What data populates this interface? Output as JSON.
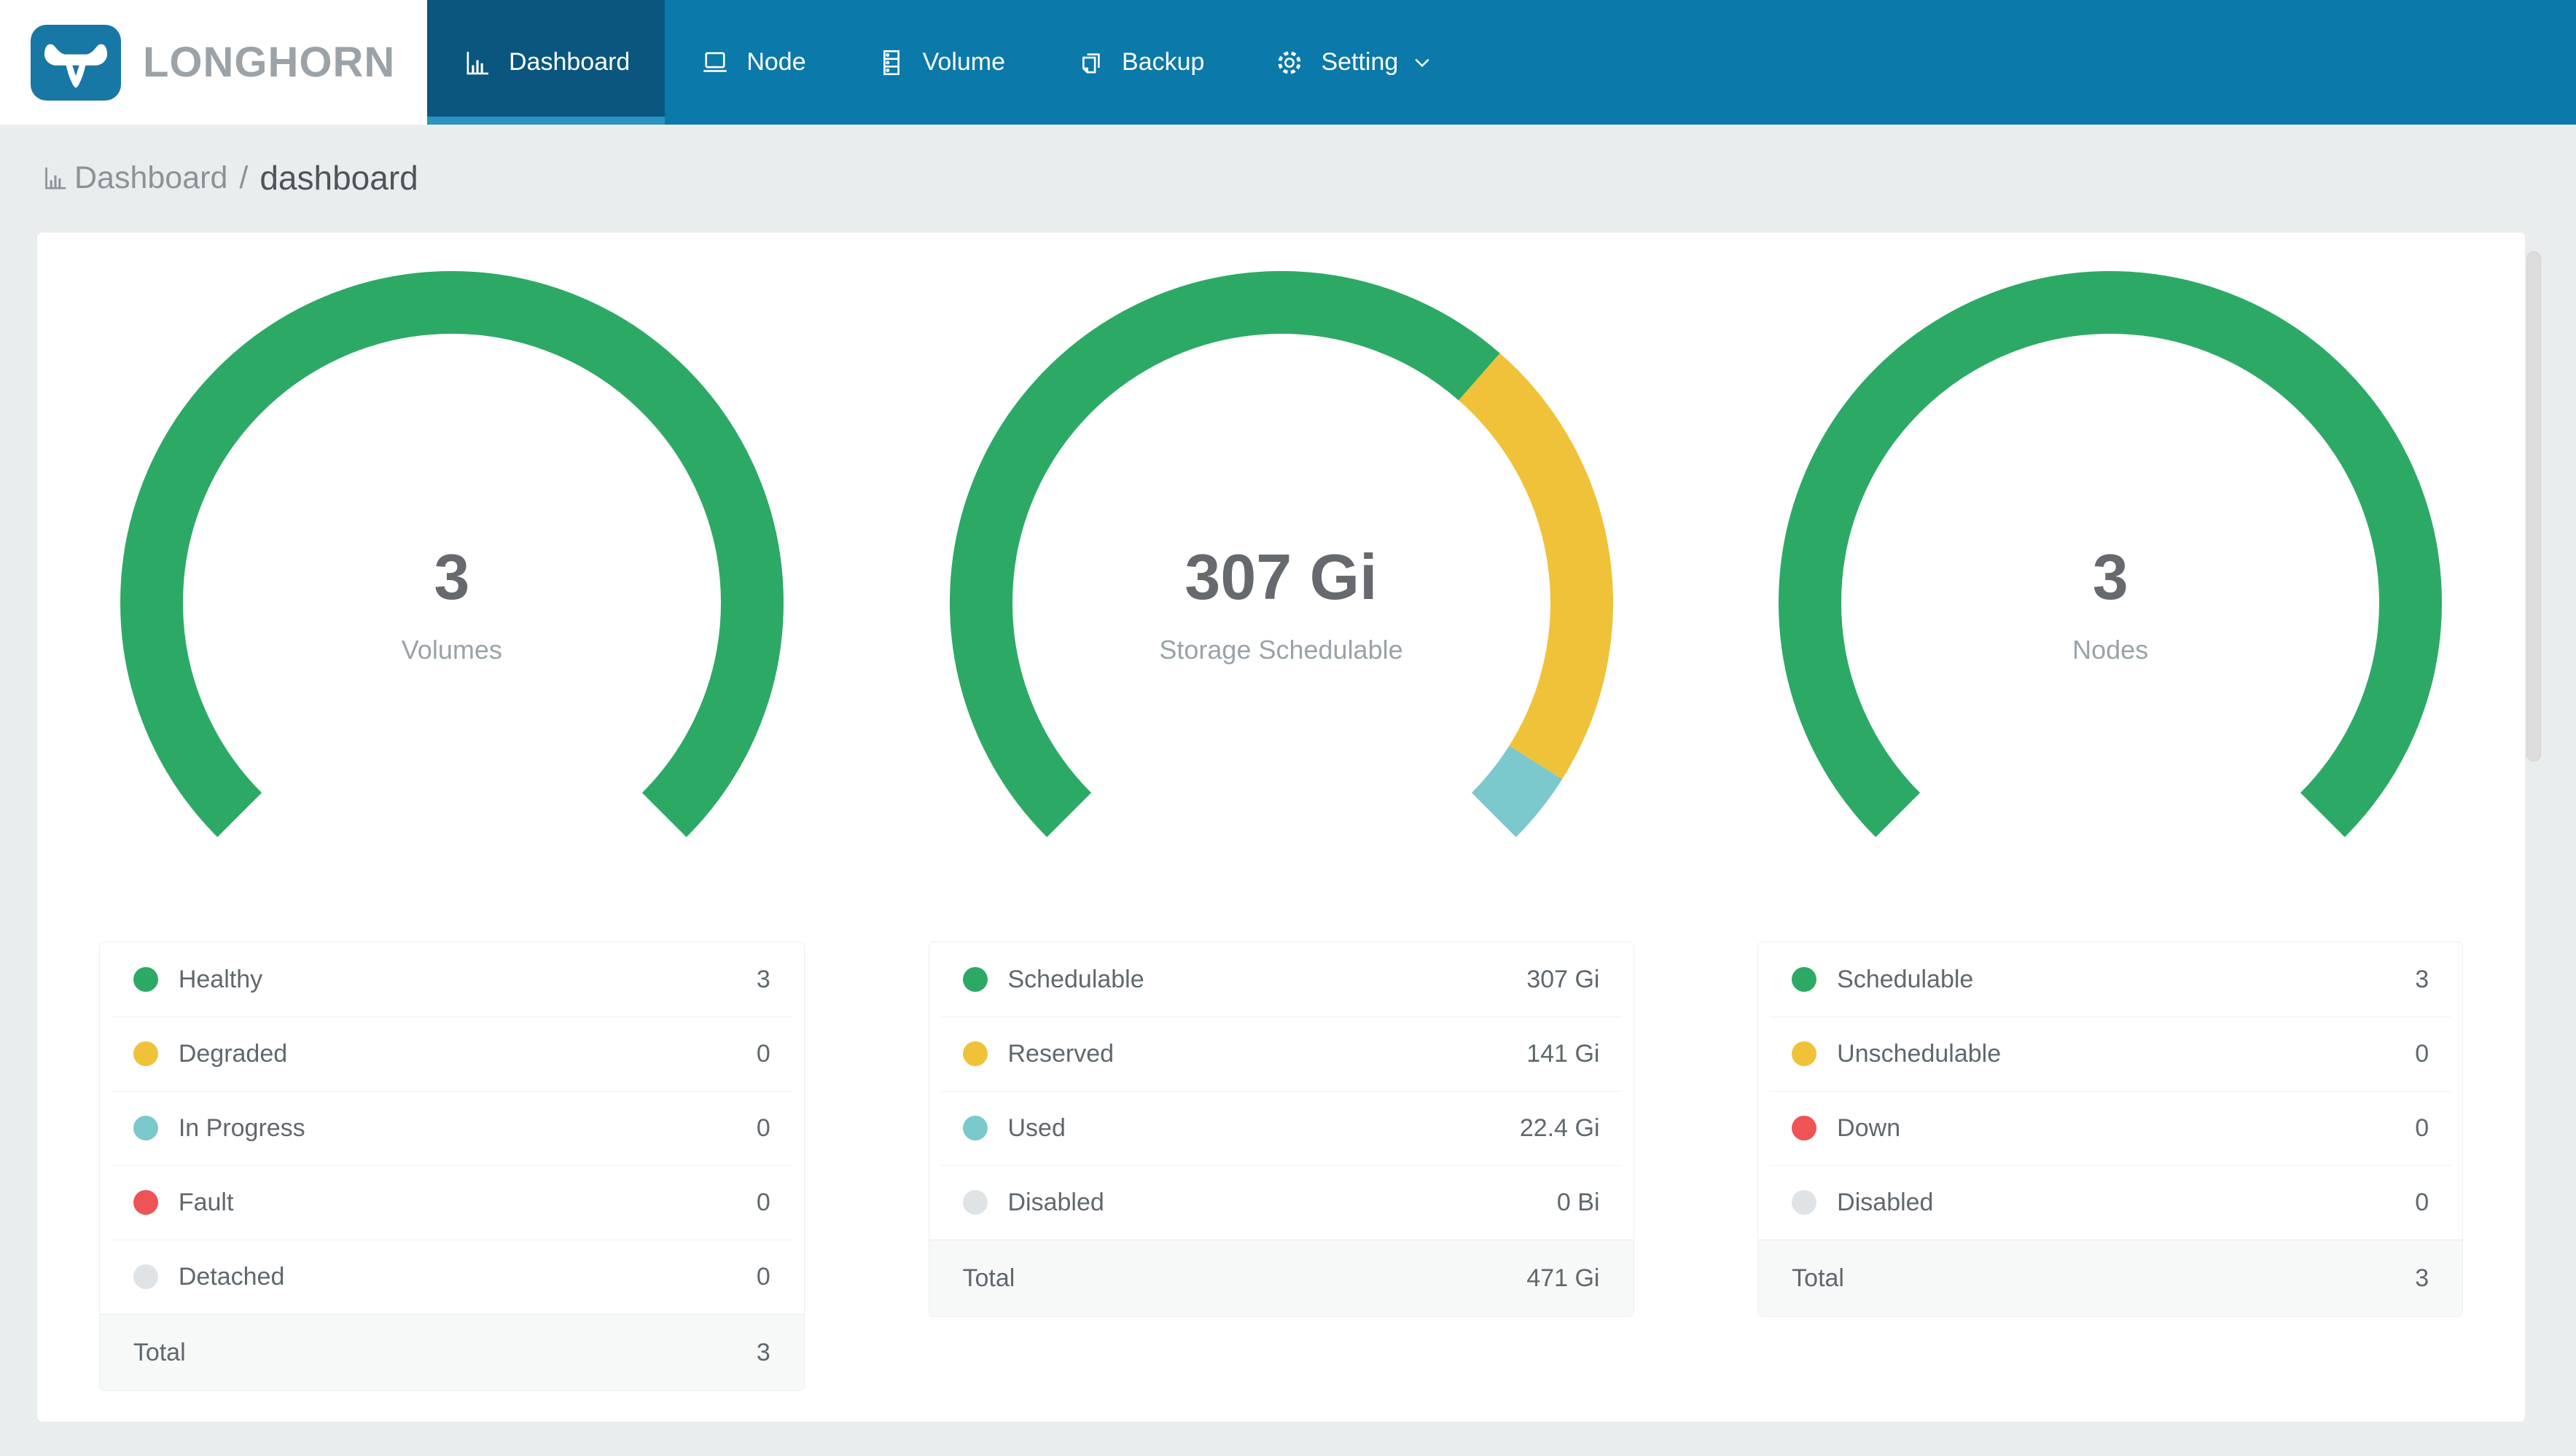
{
  "brand": {
    "name": "LONGHORN"
  },
  "nav": {
    "items": [
      {
        "label": "Dashboard",
        "icon": "bar-chart-icon",
        "active": true
      },
      {
        "label": "Node",
        "icon": "laptop-icon",
        "active": false
      },
      {
        "label": "Volume",
        "icon": "storage-icon",
        "active": false
      },
      {
        "label": "Backup",
        "icon": "copy-icon",
        "active": false
      },
      {
        "label": "Setting",
        "icon": "gear-icon",
        "active": false,
        "has_dropdown": true
      }
    ]
  },
  "breadcrumb": {
    "section": "Dashboard",
    "separator": "/",
    "page": "dashboard"
  },
  "colors": {
    "navbar": "#0B79A9",
    "navbar_active": "#0A567F",
    "active_underline": "#2B94C1",
    "brand_blue": "#1878A5",
    "healthy_green": "#2DA966",
    "warning_yellow": "#F0C239",
    "progress_teal": "#7BC8CD",
    "fault_red": "#EE5355",
    "disabled_gray": "#E0E3E6"
  },
  "chart_data": [
    {
      "type": "donut-gauge",
      "title": "Volumes",
      "center_value": "3",
      "center_label": "Volumes",
      "start_angle": 225,
      "sweep": 270,
      "segments": [
        {
          "label": "Healthy",
          "value": 3,
          "display": "3",
          "color": "#2DA966"
        },
        {
          "label": "Degraded",
          "value": 0,
          "display": "0",
          "color": "#F0C239"
        },
        {
          "label": "In Progress",
          "value": 0,
          "display": "0",
          "color": "#7BC8CD"
        },
        {
          "label": "Fault",
          "value": 0,
          "display": "0",
          "color": "#EE5355"
        },
        {
          "label": "Detached",
          "value": 0,
          "display": "0",
          "color": "#E0E3E6"
        }
      ],
      "total": {
        "label": "Total",
        "display": "3"
      }
    },
    {
      "type": "donut-gauge",
      "title": "Storage Schedulable",
      "center_value": "307 Gi",
      "center_label": "Storage Schedulable",
      "start_angle": 225,
      "sweep": 270,
      "segments": [
        {
          "label": "Schedulable",
          "value": 307,
          "display": "307 Gi",
          "color": "#2DA966"
        },
        {
          "label": "Reserved",
          "value": 141,
          "display": "141 Gi",
          "color": "#F0C239"
        },
        {
          "label": "Used",
          "value": 22.4,
          "display": "22.4 Gi",
          "color": "#7BC8CD"
        },
        {
          "label": "Disabled",
          "value": 0,
          "display": "0 Bi",
          "color": "#E0E3E6"
        }
      ],
      "total": {
        "label": "Total",
        "display": "471 Gi"
      }
    },
    {
      "type": "donut-gauge",
      "title": "Nodes",
      "center_value": "3",
      "center_label": "Nodes",
      "start_angle": 225,
      "sweep": 270,
      "segments": [
        {
          "label": "Schedulable",
          "value": 3,
          "display": "3",
          "color": "#2DA966"
        },
        {
          "label": "Unschedulable",
          "value": 0,
          "display": "0",
          "color": "#F0C239"
        },
        {
          "label": "Down",
          "value": 0,
          "display": "0",
          "color": "#EE5355"
        },
        {
          "label": "Disabled",
          "value": 0,
          "display": "0",
          "color": "#E0E3E6"
        }
      ],
      "total": {
        "label": "Total",
        "display": "3"
      }
    }
  ]
}
